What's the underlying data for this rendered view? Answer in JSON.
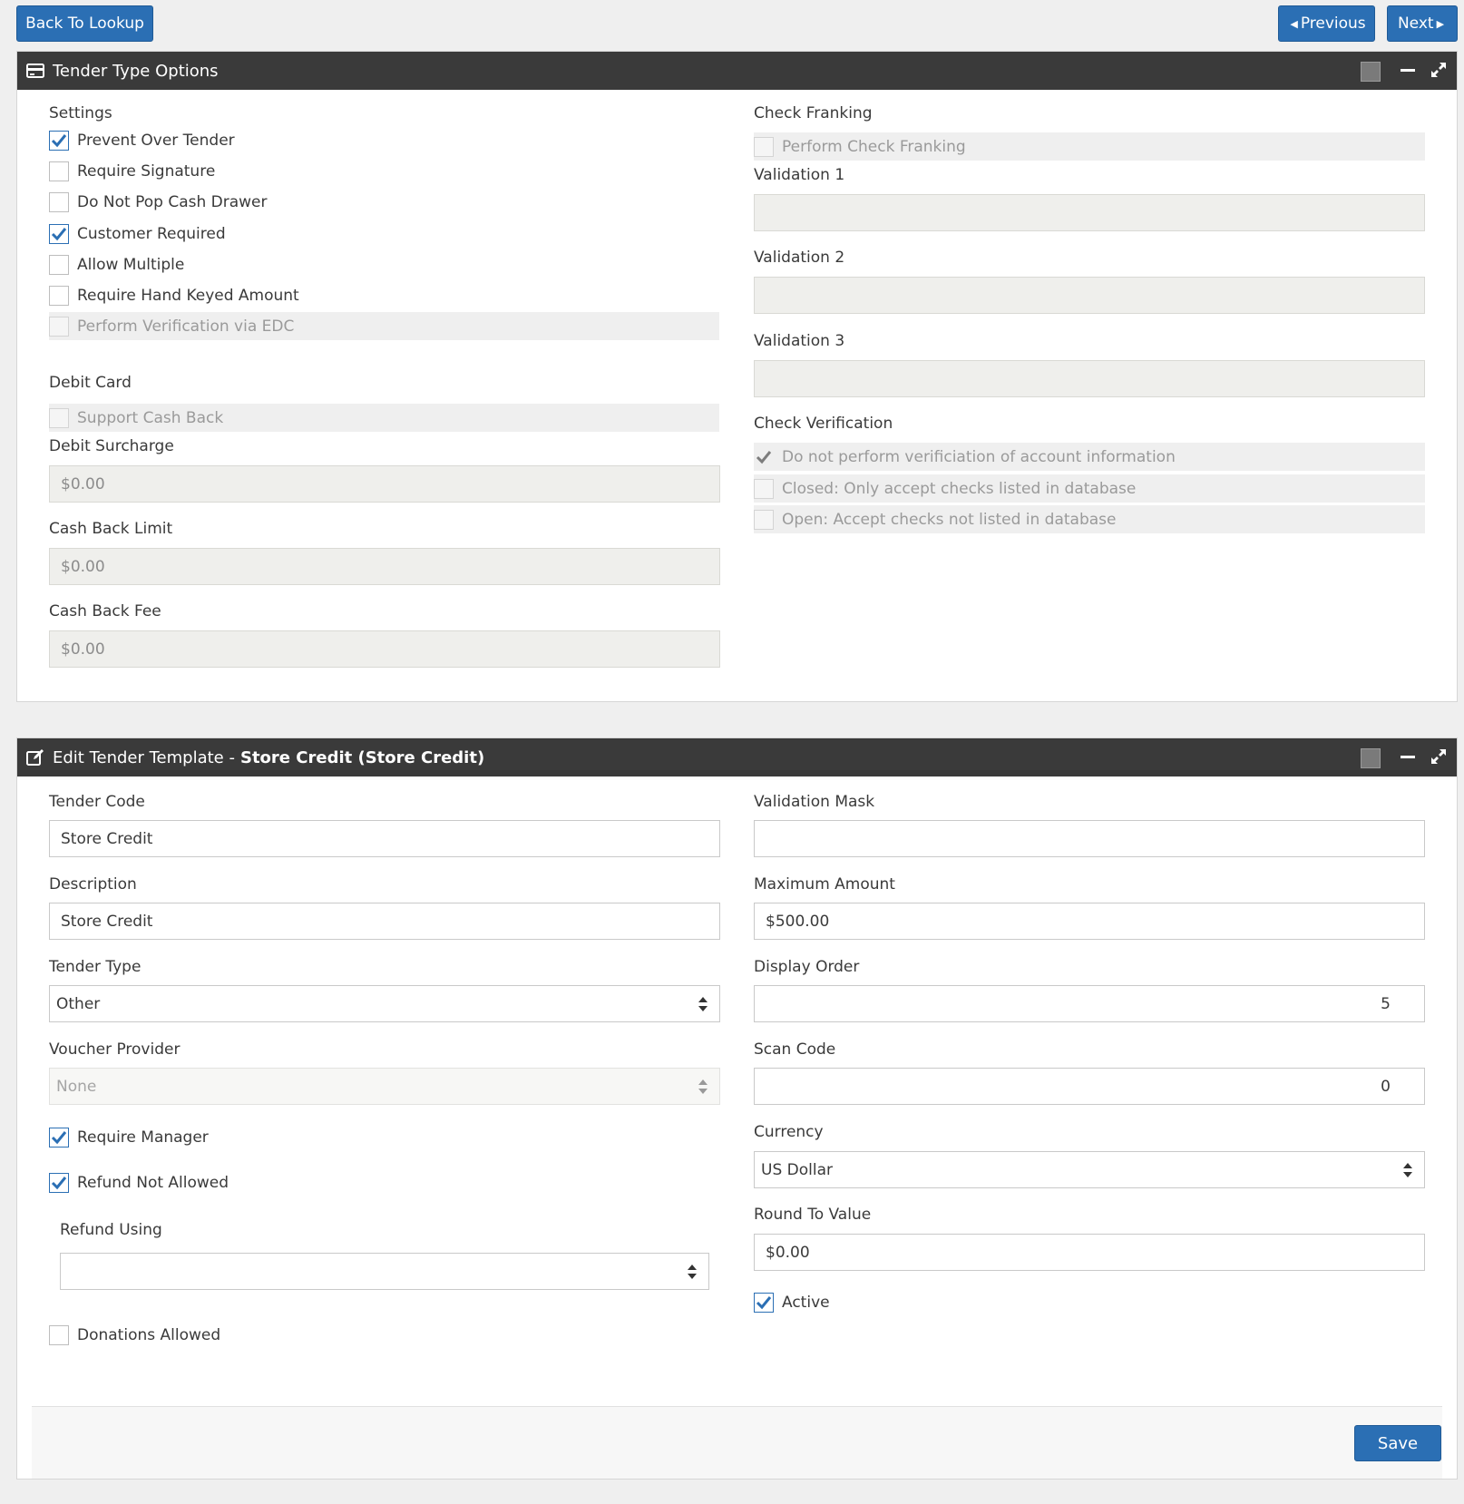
{
  "top_buttons": {
    "back": "Back To Lookup",
    "previous": "Previous",
    "next": "Next"
  },
  "tender_options": {
    "title": "Tender Type Options",
    "settings_label": "Settings",
    "settings": [
      {
        "label": "Prevent Over Tender",
        "checked": true,
        "disabled": false
      },
      {
        "label": "Require Signature",
        "checked": false,
        "disabled": false
      },
      {
        "label": "Do Not Pop Cash Drawer",
        "checked": false,
        "disabled": false
      },
      {
        "label": "Customer Required",
        "checked": true,
        "disabled": false
      },
      {
        "label": "Allow Multiple",
        "checked": false,
        "disabled": false
      },
      {
        "label": "Require Hand Keyed Amount",
        "checked": false,
        "disabled": false
      },
      {
        "label": "Perform Verification via EDC",
        "checked": false,
        "disabled": true
      }
    ],
    "debit_card_label": "Debit Card",
    "support_cash_back": {
      "label": "Support Cash Back",
      "checked": false,
      "disabled": true
    },
    "debit_surcharge": {
      "label": "Debit Surcharge",
      "value": "$0.00"
    },
    "cash_back_limit": {
      "label": "Cash Back Limit",
      "value": "$0.00"
    },
    "cash_back_fee": {
      "label": "Cash Back Fee",
      "value": "$0.00"
    },
    "check_franking_label": "Check Franking",
    "perform_check_franking": {
      "label": "Perform Check Franking",
      "checked": false,
      "disabled": true
    },
    "validation1": {
      "label": "Validation 1",
      "value": ""
    },
    "validation2": {
      "label": "Validation 2",
      "value": ""
    },
    "validation3": {
      "label": "Validation 3",
      "value": ""
    },
    "check_verification_label": "Check Verification",
    "check_verification": [
      {
        "label": "Do not perform verificiation of account information",
        "checked": true,
        "disabled": true
      },
      {
        "label": "Closed: Only accept checks listed in database",
        "checked": false,
        "disabled": true
      },
      {
        "label": "Open: Accept checks not listed in database",
        "checked": false,
        "disabled": true
      }
    ]
  },
  "edit_template": {
    "title_prefix": "Edit Tender Template -",
    "title_name": "Store Credit (Store Credit)",
    "tender_code": {
      "label": "Tender Code",
      "value": "Store Credit"
    },
    "description": {
      "label": "Description",
      "value": "Store Credit"
    },
    "tender_type": {
      "label": "Tender Type",
      "value": "Other"
    },
    "voucher_provider": {
      "label": "Voucher Provider",
      "value": "None"
    },
    "require_manager": {
      "label": "Require Manager",
      "checked": true
    },
    "refund_not_allowed": {
      "label": "Refund Not Allowed",
      "checked": true
    },
    "refund_using": {
      "label": "Refund Using",
      "value": ""
    },
    "donations_allowed": {
      "label": "Donations Allowed",
      "checked": false
    },
    "validation_mask": {
      "label": "Validation Mask",
      "value": ""
    },
    "maximum_amount": {
      "label": "Maximum Amount",
      "value": "$500.00"
    },
    "display_order": {
      "label": "Display Order",
      "value": "5"
    },
    "scan_code": {
      "label": "Scan Code",
      "value": "0"
    },
    "currency": {
      "label": "Currency",
      "value": "US Dollar"
    },
    "round_to_value": {
      "label": "Round To Value",
      "value": "$0.00"
    },
    "active": {
      "label": "Active",
      "checked": true
    },
    "save": "Save"
  },
  "colors": {
    "primary": "#2b6fb4",
    "header": "#3a3a3a",
    "disabled_bg": "#efefec"
  }
}
